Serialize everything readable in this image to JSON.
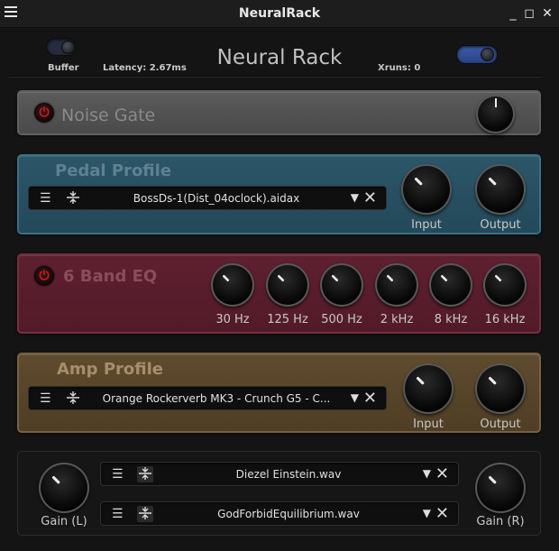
{
  "window": {
    "title": "NeuralRack",
    "menu_icon": "menu-icon",
    "minimize": "_",
    "maximize": "◻",
    "close": "✕"
  },
  "header": {
    "buffer_label": "Buffer",
    "latency": "Latency: 2.67ms",
    "app_title": "Neural Rack",
    "xruns": "Xruns: 0"
  },
  "noise_gate": {
    "title": "Noise Gate"
  },
  "pedal": {
    "title": "Pedal Profile",
    "file": "BossDs-1(Dist_04oclock).aidax",
    "input_label": "Input",
    "output_label": "Output"
  },
  "eq": {
    "title": "6 Band EQ",
    "bands": [
      "30 Hz",
      "125 Hz",
      "500 Hz",
      "2 kHz",
      "8 kHz",
      "16 kHz"
    ]
  },
  "amp": {
    "title": "Amp Profile",
    "file": "Orange Rockerverb MK3 - Crunch G5 - C...",
    "input_label": "Input",
    "output_label": "Output"
  },
  "ir": {
    "gain_left_label": "Gain (L)",
    "gain_right_label": "Gain (R)",
    "file_left": "Diezel Einstein.wav",
    "file_right": "GodForbidEquilibrium.wav"
  },
  "colors": {
    "pedal_panel": "#2c5668",
    "eq_panel": "#5e2030",
    "amp_panel": "#5f4b2e",
    "power_icon": "#d01818",
    "toggle_on": "#3c5aa8"
  }
}
